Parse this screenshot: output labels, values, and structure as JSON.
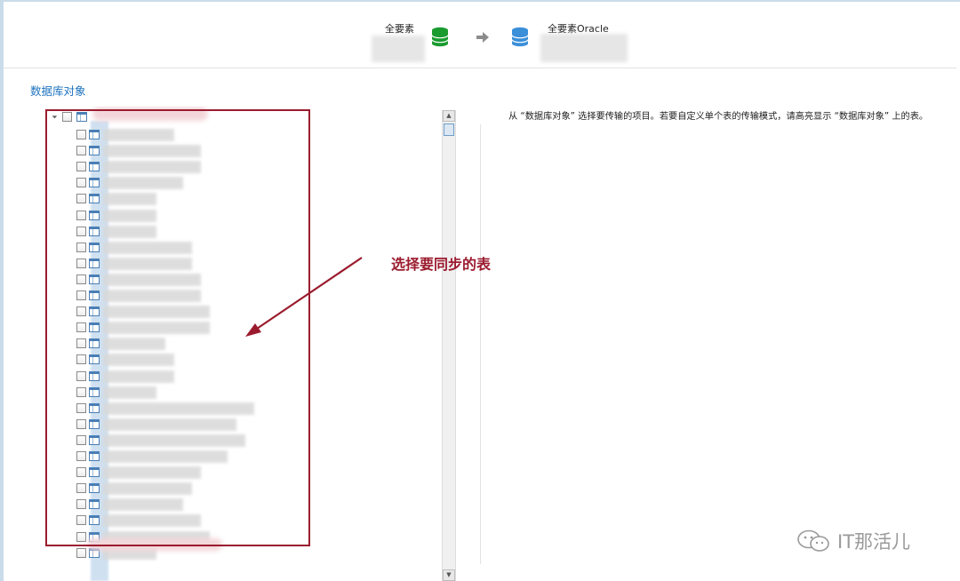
{
  "header": {
    "source_label": "全要素",
    "target_label": "全要素Oracle",
    "source_icon": "database-icon",
    "target_icon": "database-icon",
    "arrow_icon": "arrow-right-icon",
    "source_color": "#1a9b2f",
    "target_color": "#3b8fd9"
  },
  "section": {
    "title": "数据库对象"
  },
  "description": {
    "text": "从 “数据库对象” 选择要传输的项目。若要自定义单个表的传输模式，请高亮显示 “数据库对象” 上的表。"
  },
  "annotation": {
    "text": "选择要同步的表",
    "color": "#9b1b2e"
  },
  "watermark": {
    "text": "IT那活儿",
    "icon": "wechat-icon"
  },
  "colors": {
    "accent": "#1e73be",
    "highlight": "#9b1b2e"
  }
}
